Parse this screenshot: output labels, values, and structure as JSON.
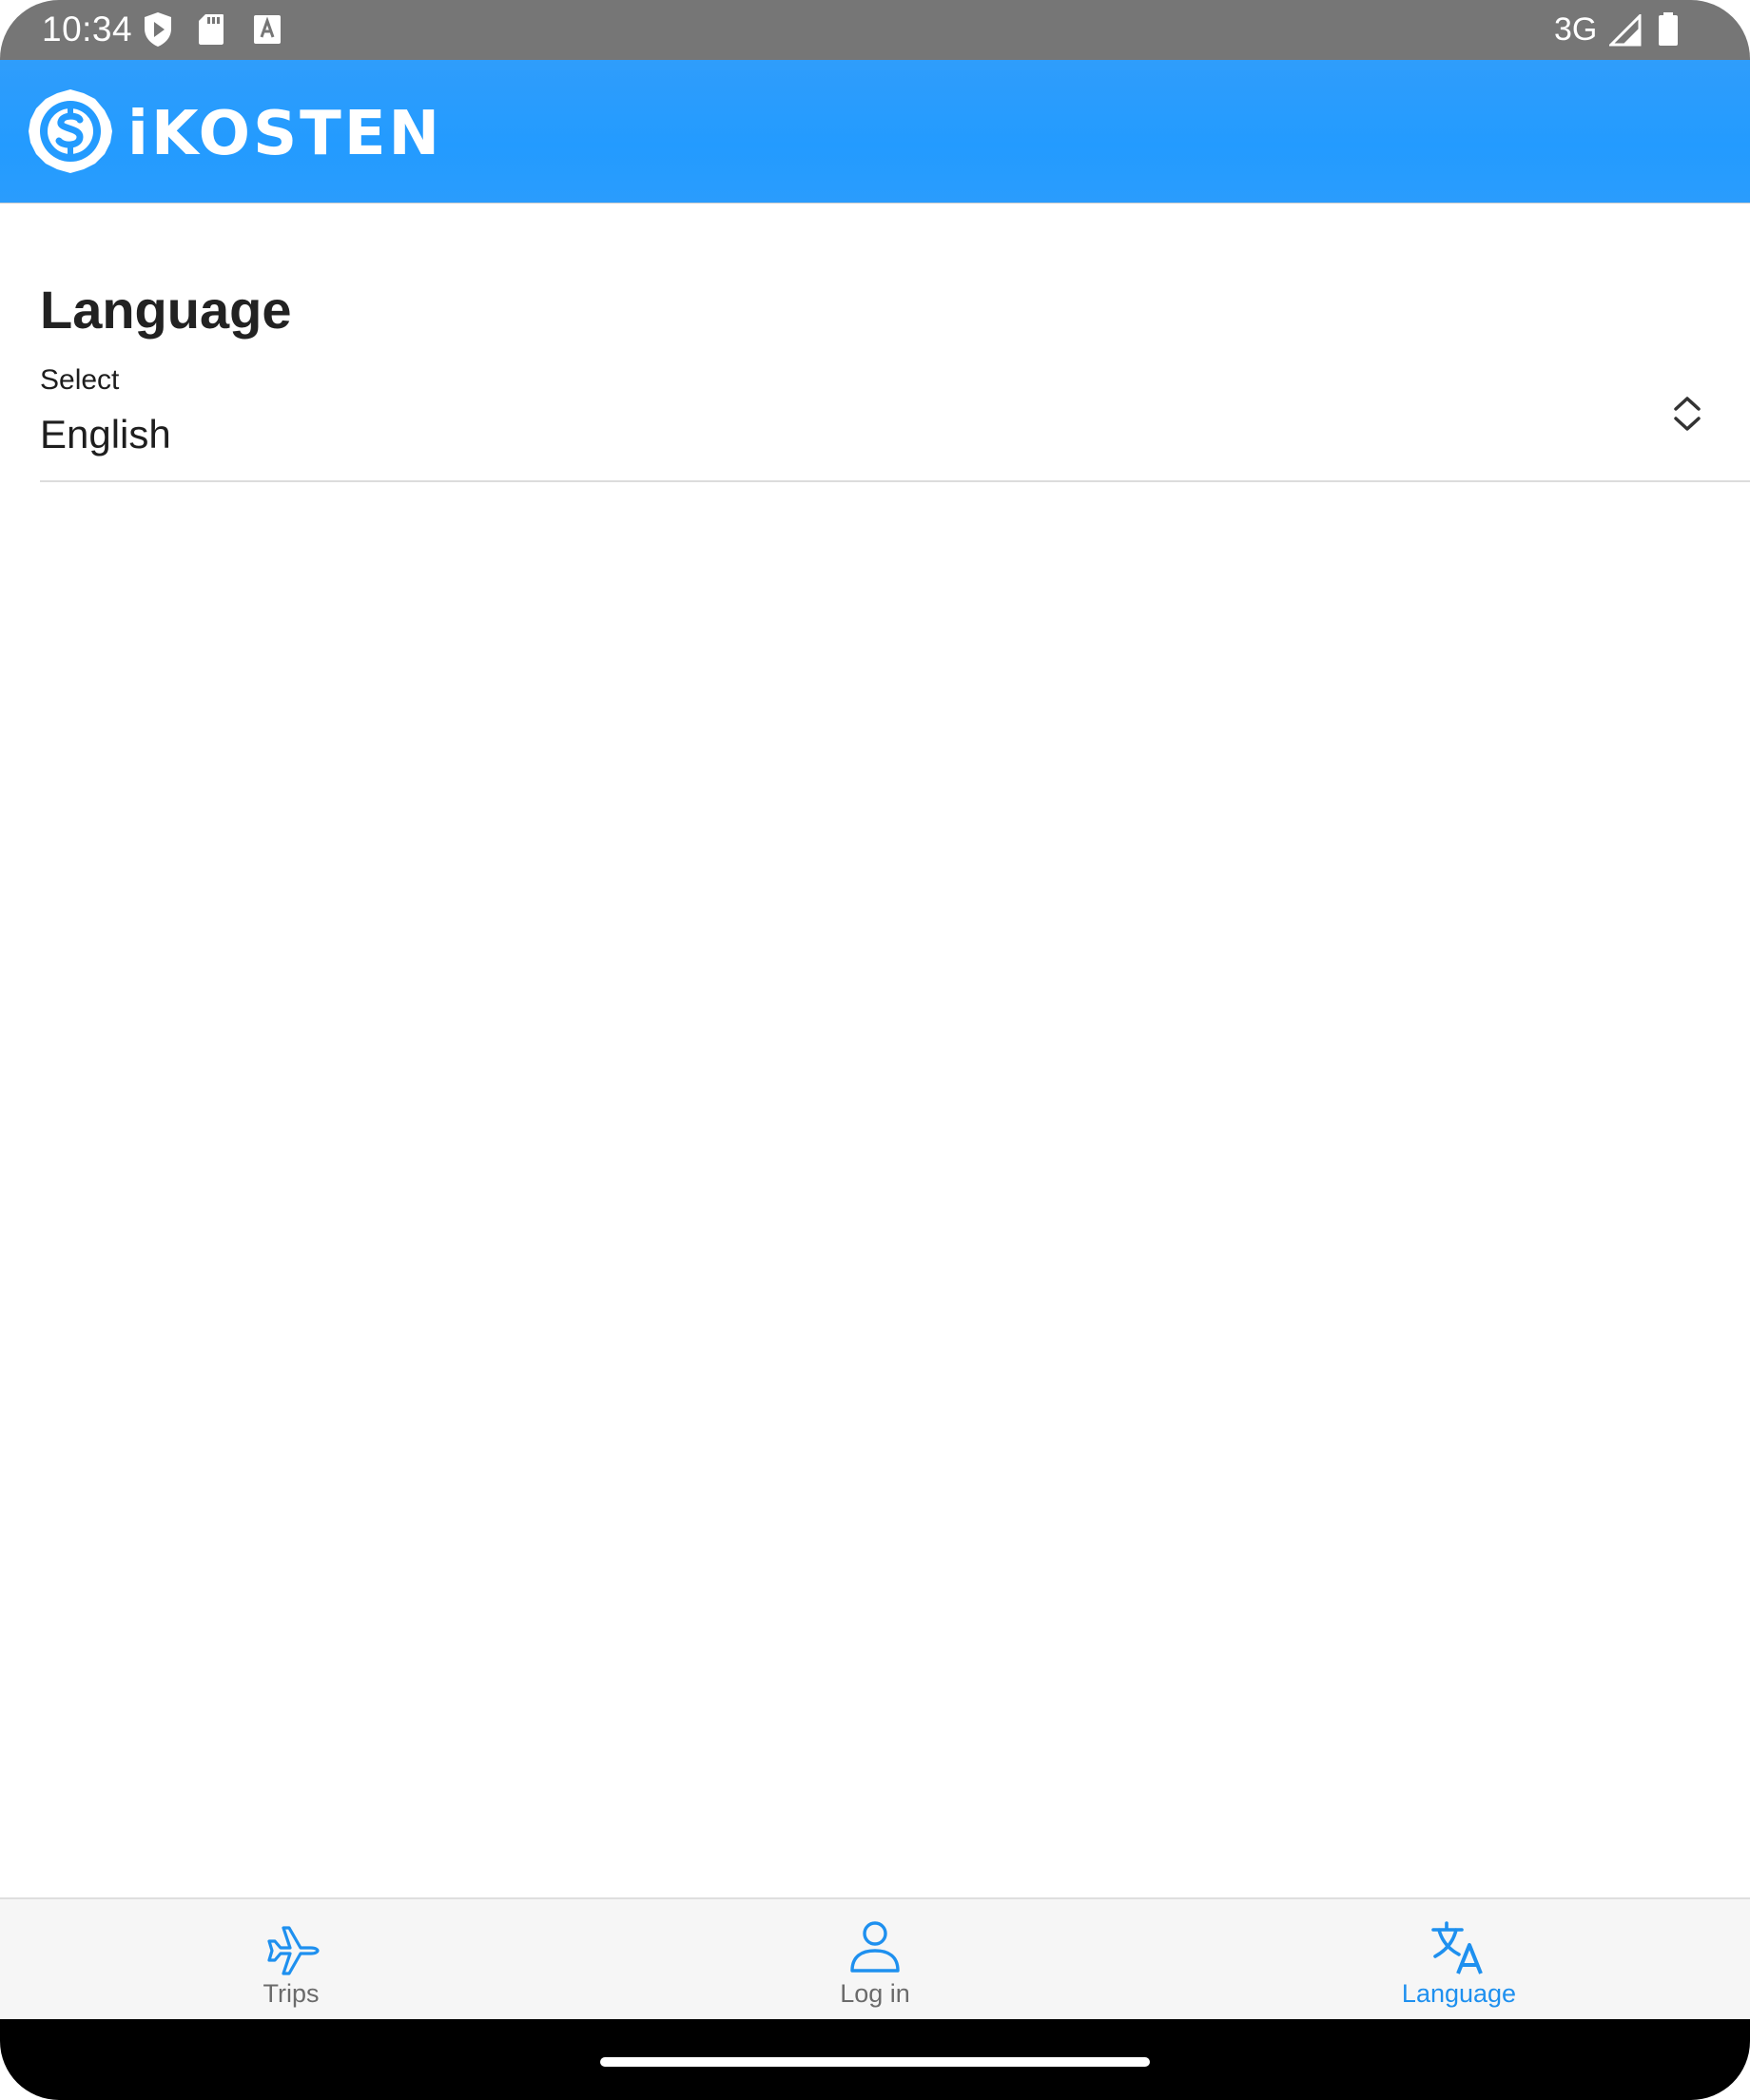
{
  "status_bar": {
    "time": "10:34",
    "network": "3G",
    "icons": [
      "shield-play-icon",
      "sd-card-icon",
      "keyboard-a-icon",
      "cell-signal-icon",
      "battery-icon"
    ]
  },
  "header": {
    "logo_text": "iKOSTEN",
    "logo_icon": "dollar-badge-icon",
    "background_color": "#239bff"
  },
  "main": {
    "title": "Language",
    "select": {
      "label": "Select",
      "value": "English",
      "icon": "chevron-up-down-icon"
    }
  },
  "tab_bar": {
    "tabs": [
      {
        "label": "Trips",
        "icon": "airplane-icon",
        "active": false
      },
      {
        "label": "Log in",
        "icon": "person-icon",
        "active": false
      },
      {
        "label": "Language",
        "icon": "translate-icon",
        "active": true
      }
    ],
    "active_color": "#1e90ef",
    "inactive_color": "#6b6b6b"
  }
}
